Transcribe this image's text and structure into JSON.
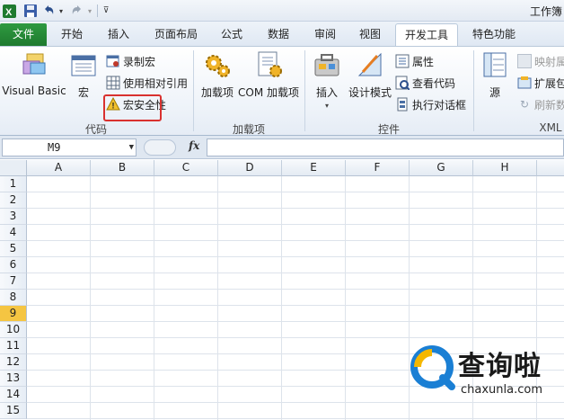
{
  "window": {
    "title": "工作簿"
  },
  "quick_access": {
    "save_icon": "save-icon",
    "undo_icon": "undo-icon",
    "redo_icon": "redo-icon"
  },
  "tabs": [
    {
      "id": "file",
      "label": "文件"
    },
    {
      "id": "home",
      "label": "开始"
    },
    {
      "id": "insert",
      "label": "插入"
    },
    {
      "id": "page_layout",
      "label": "页面布局"
    },
    {
      "id": "formulas",
      "label": "公式"
    },
    {
      "id": "data",
      "label": "数据"
    },
    {
      "id": "review",
      "label": "审阅"
    },
    {
      "id": "view",
      "label": "视图"
    },
    {
      "id": "developer",
      "label": "开发工具",
      "active": true
    },
    {
      "id": "special",
      "label": "特色功能"
    }
  ],
  "ribbon": {
    "code_group": {
      "label": "代码",
      "visual_basic": "Visual Basic",
      "macros": "宏",
      "record_macro": "录制宏",
      "relative_ref": "使用相对引用",
      "macro_security": "宏安全性"
    },
    "addins_group": {
      "label": "加载项",
      "addins": "加载项",
      "com_addins": "COM 加载项"
    },
    "controls_group": {
      "label": "控件",
      "insert": "插入",
      "design_mode": "设计模式",
      "properties": "属性",
      "view_code": "查看代码",
      "run_dialog": "执行对话框"
    },
    "xml_group": {
      "label": "XML",
      "source": "源",
      "map_properties": "映射属",
      "expansion_packs": "扩展包",
      "refresh_data": "刷新数"
    }
  },
  "formula_bar": {
    "name_box": "M9",
    "fx_label": "fx",
    "formula": ""
  },
  "grid": {
    "columns": [
      "A",
      "B",
      "C",
      "D",
      "E",
      "F",
      "G",
      "H"
    ],
    "rows": [
      "1",
      "2",
      "3",
      "4",
      "5",
      "6",
      "7",
      "8",
      "9",
      "10",
      "11",
      "12",
      "13",
      "14",
      "15"
    ],
    "active_row": "9"
  },
  "watermark": {
    "text": "查询啦",
    "url": "chaxunla.com"
  },
  "colors": {
    "file_tab": "#1e7a2f",
    "highlight": "#d9312f",
    "active_row": "#f5c542",
    "accent": "#1a7fd4"
  }
}
